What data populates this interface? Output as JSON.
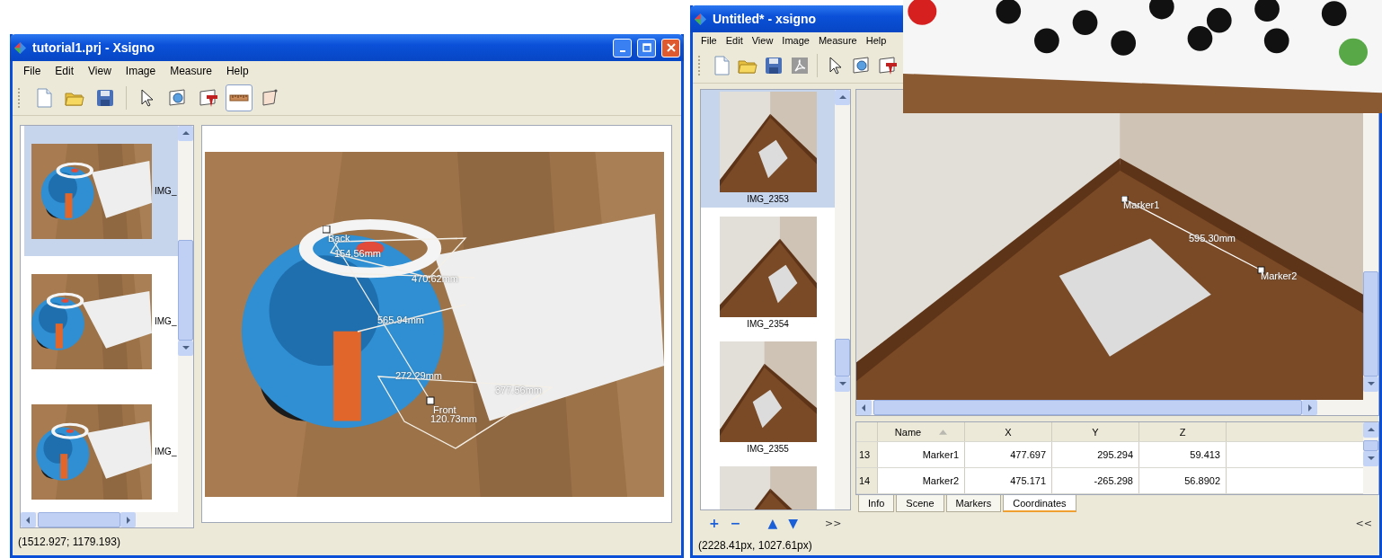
{
  "window_left": {
    "title": "tutorial1.prj - Xsigno",
    "menu": [
      "File",
      "Edit",
      "View",
      "Image",
      "Measure",
      "Help"
    ],
    "toolbar": [
      {
        "kind": "new",
        "selected": false
      },
      {
        "kind": "open",
        "selected": false
      },
      {
        "kind": "save",
        "selected": false
      },
      {
        "kind": "pointer",
        "selected": false
      },
      {
        "kind": "zoom",
        "selected": false
      },
      {
        "kind": "marker",
        "selected": false
      },
      {
        "kind": "ruler",
        "selected": true
      },
      {
        "kind": "polygon",
        "selected": false
      }
    ],
    "thumbnails": [
      {
        "label": "IMG_",
        "selected": true
      },
      {
        "label": "IMG_",
        "selected": false
      },
      {
        "label": "IMG_",
        "selected": false
      }
    ],
    "annotations": [
      "Back",
      "154.56mm",
      "470.62mm",
      "565.94mm",
      "272.29mm",
      "377.56mm",
      "Front",
      "120.73mm"
    ],
    "status": "(1512.927; 1179.193)"
  },
  "window_right": {
    "title": "Untitled* - xsigno",
    "menu": [
      "File",
      "Edit",
      "View",
      "Image",
      "Measure",
      "Help"
    ],
    "toolbar": [
      {
        "kind": "new",
        "selected": false
      },
      {
        "kind": "open",
        "selected": false
      },
      {
        "kind": "save",
        "selected": false
      },
      {
        "kind": "pdf",
        "selected": false
      },
      {
        "kind": "pointer",
        "selected": false
      },
      {
        "kind": "zoom",
        "selected": false
      },
      {
        "kind": "marker",
        "selected": false
      }
    ],
    "thumbnails": [
      {
        "label": "IMG_2353",
        "selected": true
      },
      {
        "label": "IMG_2354",
        "selected": false
      },
      {
        "label": "IMG_2355",
        "selected": false
      },
      {
        "selected": false
      }
    ],
    "thumb_buttons": [
      "+",
      "−",
      "▲",
      "▼",
      ">>"
    ],
    "annotations": [
      "Marker1",
      "595.30mm",
      "Marker2"
    ],
    "table": {
      "columns": [
        {
          "label": "Name",
          "sorted": true
        },
        {
          "label": "X"
        },
        {
          "label": "Y"
        },
        {
          "label": "Z"
        }
      ],
      "rows": [
        {
          "index": "13",
          "cells": [
            "Marker1",
            "477.697",
            "295.294",
            "59.413"
          ]
        },
        {
          "index": "14",
          "cells": [
            "Marker2",
            "475.171",
            "-265.298",
            "56.8902"
          ]
        }
      ]
    },
    "tabs": [
      {
        "label": "Info",
        "selected": false
      },
      {
        "label": "Scene",
        "selected": false
      },
      {
        "label": "Markers",
        "selected": false
      },
      {
        "label": "Coordinates",
        "selected": true
      }
    ],
    "collapse_button": "<<",
    "status": "(2228.41px, 1027.61px)"
  }
}
